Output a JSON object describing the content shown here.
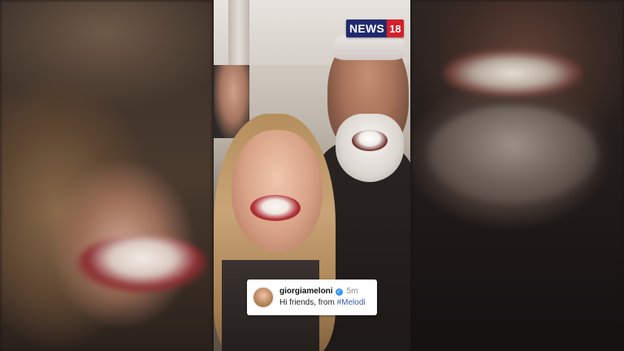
{
  "logo": {
    "word": "NEWS",
    "number": "18"
  },
  "comment": {
    "username": "giorgiameloni",
    "verified_icon": "verified-badge-icon",
    "time": "5m",
    "text": "Hi friends, from ",
    "hashtag": "#Melodi"
  },
  "colors": {
    "logo_blue": "#1f2a6e",
    "logo_red": "#d4202a",
    "verified": "#3b95f0",
    "hashtag": "#3b5ba8"
  }
}
